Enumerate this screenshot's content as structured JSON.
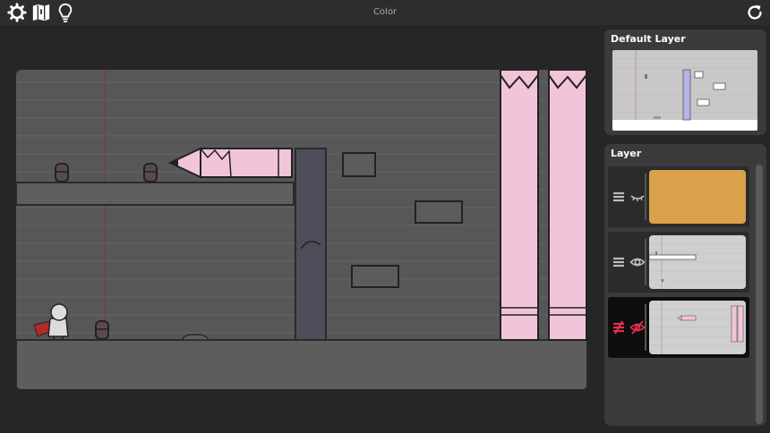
{
  "header": {
    "title": "Color",
    "icons": [
      "gear-icon",
      "map-icon",
      "lightbulb-icon",
      "restart-icon"
    ]
  },
  "panels": {
    "preview_title": "Default Layer",
    "layers_title": "Layer"
  },
  "layers": [
    {
      "handle": "menu-icon",
      "visibility": "eye-closed-icon",
      "thumb_color": "#d9a24a",
      "selected": false
    },
    {
      "handle": "menu-icon",
      "visibility": "eye-icon",
      "thumb_color": "#cfcfcf",
      "selected": false
    },
    {
      "handle": "no-reorder-icon",
      "visibility": "eye-off-icon",
      "thumb_color": "#cfcfcf",
      "selected": true
    }
  ],
  "colors": {
    "background": "#262626",
    "pencil_pink": "#f2c4da",
    "wall_purple": "#4e4d5a",
    "accent_red": "#e0304c",
    "layer_orange": "#d9a24a"
  }
}
